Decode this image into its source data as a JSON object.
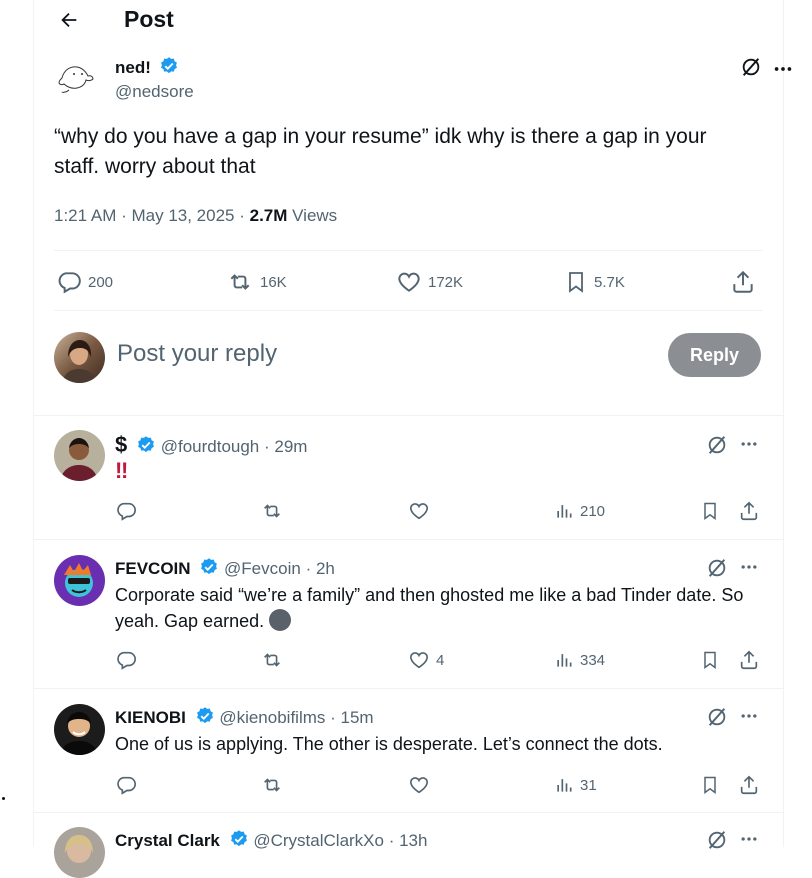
{
  "header": {
    "title": "Post"
  },
  "post": {
    "author_name": "ned!",
    "author_handle": "@nedsore",
    "text": "“why do you have a gap in your resume” idk why is there a gap in your staff. worry about that",
    "timestamp": "1:21 AM · May 13, 2025 · ",
    "views_count": "2.7M",
    "views_label": " Views",
    "stats": {
      "replies": "200",
      "reposts": "16K",
      "likes": "172K",
      "bookmarks": "5.7K"
    }
  },
  "composer": {
    "placeholder": "Post your reply",
    "button_label": "Reply"
  },
  "replies": [
    {
      "name": "$",
      "handle": "@fourdtough",
      "time": "· 29m",
      "text": "‼",
      "likes": "",
      "views": "210"
    },
    {
      "name": "FEVCOIN",
      "handle": "@Fevcoin",
      "time": "· 2h",
      "text": "Corporate said “we’re a family” and then ghosted me like a bad Tinder date. So yeah. Gap earned.",
      "likes": "4",
      "views": "334"
    },
    {
      "name": "KIENOBI",
      "handle": "@kienobifilms",
      "time": "· 15m",
      "text": "One of us is applying. The other is desperate. Let’s connect the dots.",
      "likes": "",
      "views": "31"
    },
    {
      "name": "Crystal Clark",
      "handle": "@CrystalClarkXo",
      "time": "· 13h"
    }
  ],
  "colors": {
    "verified": "#1d9bf0",
    "muted": "#536471",
    "reply_button": "#8b8f93",
    "accent_red": "#c3183a"
  }
}
